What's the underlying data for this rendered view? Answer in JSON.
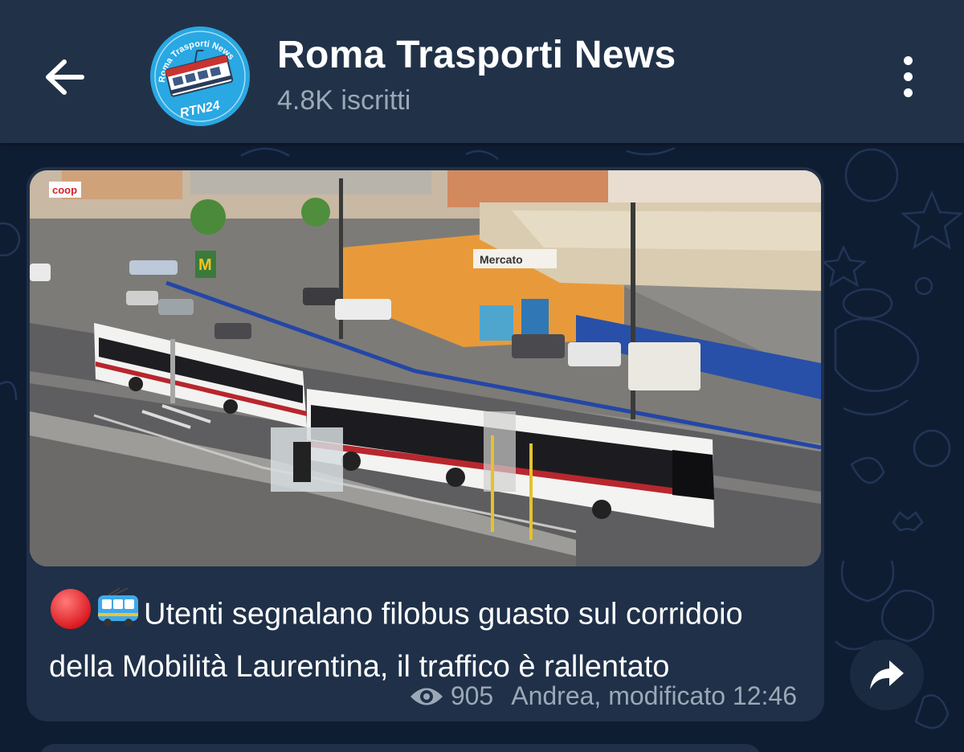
{
  "header": {
    "channel_name": "Roma Trasporti News",
    "subscribers": "4.8K iscritti",
    "avatar_text_top": "Roma Trasporti News",
    "avatar_text_bottom": "RTN24"
  },
  "message": {
    "caption": "Utenti segnalano filobus guasto sul corridoio della Mobilità Laurentina, il traffico è rallentato",
    "views": "905",
    "signature": "Andrea, modificato 12:46",
    "emojis": [
      "red-circle",
      "trolleybus"
    ],
    "photo_signs": {
      "market": "Mercato",
      "coop": "coop",
      "mcdonalds": "M"
    }
  },
  "colors": {
    "header_bg": "#213248",
    "chat_bg": "#0f1d33",
    "bubble_bg": "#1f3048",
    "muted_text": "#9ba8b6",
    "avatar_blue": "#27a9e6"
  },
  "icons": {
    "back": "arrow-left-icon",
    "menu": "more-vertical-icon",
    "views": "eye-icon",
    "share": "share-arrow-icon"
  }
}
